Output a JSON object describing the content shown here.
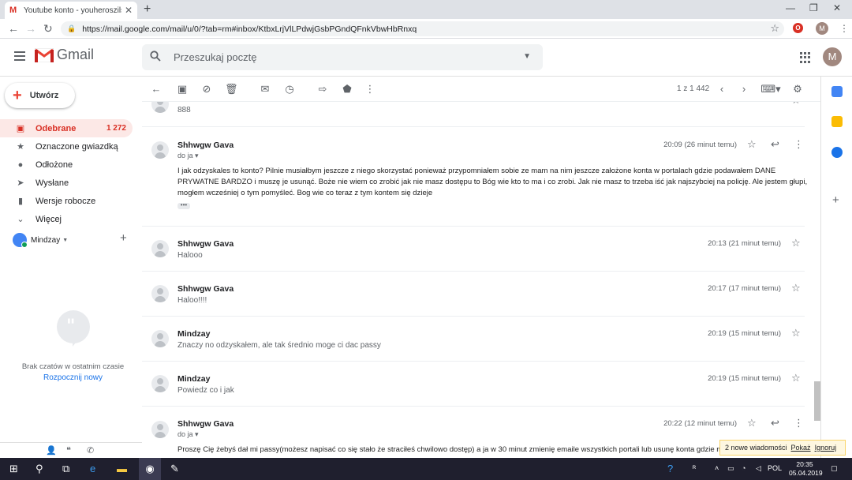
{
  "browser": {
    "tab_title": "Youtube konto - youheroszilsu@",
    "tab_close": "✕",
    "new_tab": "+",
    "url": "https://mail.google.com/mail/u/0/?tab=rm#inbox/KtbxLrjVlLPdwjGsbPGndQFnkVbwHbRnxq",
    "profile_initial": "M",
    "ext_label": "O"
  },
  "header": {
    "logo_text": "Gmail",
    "search_placeholder": "Przeszukaj pocztę",
    "avatar_initial": "M"
  },
  "sidebar": {
    "compose_label": "Utwórz",
    "items": [
      {
        "label": "Odebrane",
        "count": "1 272",
        "icon": "inbox-icon"
      },
      {
        "label": "Oznaczone gwiazdką",
        "count": "",
        "icon": "star-icon"
      },
      {
        "label": "Odłożone",
        "count": "",
        "icon": "clock-icon"
      },
      {
        "label": "Wysłane",
        "count": "",
        "icon": "send-icon"
      },
      {
        "label": "Wersje robocze",
        "count": "",
        "icon": "file-icon"
      },
      {
        "label": "Więcej",
        "count": "",
        "icon": "chevron-down-icon"
      }
    ],
    "hangouts_user": "Mindzay",
    "no_chats": "Brak czatów w ostatnim czasie",
    "start_new": "Rozpocznij nowy"
  },
  "toolbar": {
    "pager": "1 z 1 442"
  },
  "thread": {
    "messages": [
      {
        "sender": "",
        "snippet": "888",
        "time": "",
        "expanded": false
      },
      {
        "sender": "Shhwgw Gava",
        "recipient": "do ja",
        "time": "20:09 (26 minut temu)",
        "body": "I jak odzyskales to konto? Pilnie musiałbym jeszcze z niego skorzystać ponieważ przypomniałem sobie ze mam na nim jeszcze założone konta w portalach gdzie podawałem DANE PRYWATNE BARDZO i muszę je usunąć. Boże nie wiem co zrobić jak nie masz dostępu to Bóg wie kto to ma i co zrobi. Jak nie masz to trzeba iść jak najszybciej na policję. Ale jestem głupi, mogłem wcześniej o tym pomyśleć. Bog wie co teraz z tym kontem się dzieje",
        "dots": "•••",
        "expanded": true
      },
      {
        "sender": "Shhwgw Gava",
        "snippet": "Halooo",
        "time": "20:13 (21 minut temu)",
        "expanded": false
      },
      {
        "sender": "Shhwgw Gava",
        "snippet": "Haloo!!!!",
        "time": "20:17 (17 minut temu)",
        "expanded": false
      },
      {
        "sender": "Mindzay",
        "snippet": "Znaczy no odzyskałem, ale tak średnio moge ci dac passy",
        "time": "20:19 (15 minut temu)",
        "expanded": false
      },
      {
        "sender": "Mindzay",
        "snippet": "Powiedz co i jak",
        "time": "20:19 (15 minut temu)",
        "expanded": false
      },
      {
        "sender": "Shhwgw Gava",
        "recipient": "do ja",
        "time": "20:22 (12 minut temu)",
        "body": "Proszę Cię żebyś dał mi passy(możesz napisać co się stało że straciłeś chwilowo dostęp) a ja w 30 minut zmienię emaile wszystkich portali lub usunę konta gdzie mam p",
        "expanded": true
      }
    ]
  },
  "notification": {
    "text": "2 nowe wiadomości",
    "show": "Pokaż",
    "ignore": "Ignoruj"
  },
  "taskbar": {
    "lang": "POL",
    "time": "20:35",
    "date": "05.04.2019"
  },
  "colors": {
    "accent_red": "#d93025",
    "inbox_bg": "#fce8e6",
    "link_blue": "#1a73e8"
  }
}
